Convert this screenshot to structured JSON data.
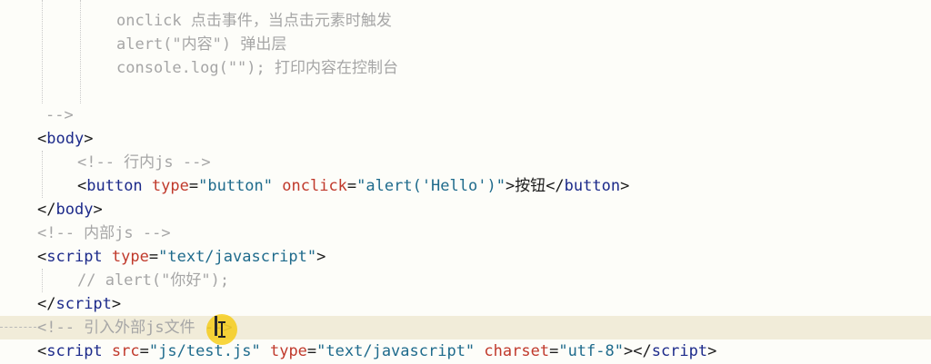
{
  "editor": {
    "lines": [
      {
        "parts": [
          {
            "cls": "c",
            "text": "onclick 点击事件，当点击元素时触发"
          }
        ]
      },
      {
        "parts": [
          {
            "cls": "c",
            "text": "alert(\"内容\") 弹出层"
          }
        ]
      },
      {
        "parts": [
          {
            "cls": "c",
            "text": "console.log(\"\"); 打印内容在控制台"
          }
        ]
      },
      {
        "parts": []
      },
      {
        "parts": [
          {
            "cls": "c",
            "text": "-->"
          }
        ]
      },
      {
        "parts": [
          {
            "cls": "p",
            "text": "<"
          },
          {
            "cls": "t",
            "text": "body"
          },
          {
            "cls": "p",
            "text": ">"
          }
        ]
      },
      {
        "parts": [
          {
            "cls": "c",
            "text": "<!-- 行内js -->"
          }
        ]
      },
      {
        "parts": [
          {
            "cls": "p",
            "text": "<"
          },
          {
            "cls": "t",
            "text": "button"
          },
          {
            "cls": "p",
            "text": " "
          },
          {
            "cls": "a",
            "text": "type"
          },
          {
            "cls": "p",
            "text": "="
          },
          {
            "cls": "s",
            "text": "\"button\""
          },
          {
            "cls": "p",
            "text": " "
          },
          {
            "cls": "a",
            "text": "onclick"
          },
          {
            "cls": "p",
            "text": "="
          },
          {
            "cls": "s",
            "text": "\"alert('Hello')\""
          },
          {
            "cls": "p",
            "text": ">"
          },
          {
            "cls": "x",
            "text": "按钮"
          },
          {
            "cls": "p",
            "text": "</"
          },
          {
            "cls": "t",
            "text": "button"
          },
          {
            "cls": "p",
            "text": ">"
          }
        ]
      },
      {
        "parts": [
          {
            "cls": "p",
            "text": "</"
          },
          {
            "cls": "t",
            "text": "body"
          },
          {
            "cls": "p",
            "text": ">"
          }
        ]
      },
      {
        "parts": [
          {
            "cls": "c",
            "text": "<!-- 内部js -->"
          }
        ]
      },
      {
        "parts": [
          {
            "cls": "p",
            "text": "<"
          },
          {
            "cls": "t",
            "text": "script"
          },
          {
            "cls": "p",
            "text": " "
          },
          {
            "cls": "a",
            "text": "type"
          },
          {
            "cls": "p",
            "text": "="
          },
          {
            "cls": "s",
            "text": "\"text/javascript\""
          },
          {
            "cls": "p",
            "text": ">"
          }
        ]
      },
      {
        "parts": [
          {
            "cls": "c",
            "text": "// alert(\"你好\");"
          }
        ]
      },
      {
        "parts": [
          {
            "cls": "p",
            "text": "</"
          },
          {
            "cls": "t",
            "text": "script"
          },
          {
            "cls": "p",
            "text": ">"
          }
        ]
      },
      {
        "parts": [
          {
            "cls": "c",
            "text": "<!-- 引入外部js文件 -->"
          }
        ]
      },
      {
        "parts": [
          {
            "cls": "p",
            "text": "<"
          },
          {
            "cls": "t",
            "text": "script"
          },
          {
            "cls": "p",
            "text": " "
          },
          {
            "cls": "a",
            "text": "src"
          },
          {
            "cls": "p",
            "text": "="
          },
          {
            "cls": "s",
            "text": "\"js/test.js\""
          },
          {
            "cls": "p",
            "text": " "
          },
          {
            "cls": "a",
            "text": "type"
          },
          {
            "cls": "p",
            "text": "="
          },
          {
            "cls": "s",
            "text": "\"text/javascript\""
          },
          {
            "cls": "p",
            "text": " "
          },
          {
            "cls": "a",
            "text": "charset"
          },
          {
            "cls": "p",
            "text": "="
          },
          {
            "cls": "s",
            "text": "\"utf-8\""
          },
          {
            "cls": "p",
            "text": "></"
          },
          {
            "cls": "t",
            "text": "script"
          },
          {
            "cls": "p",
            "text": ">"
          }
        ]
      }
    ],
    "current_line": 13,
    "colors": {
      "tag": "#1c2a8a",
      "attribute": "#c0392b",
      "string": "#1f6b8c",
      "comment": "#a6a6a6",
      "current_line_bg": "#f1ecd9",
      "click_indicator": "#f5c800"
    }
  }
}
